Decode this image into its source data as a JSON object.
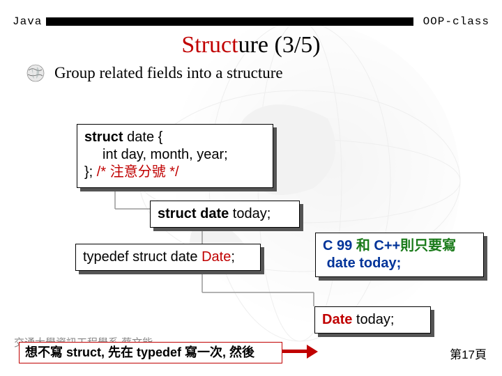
{
  "header": {
    "left_label": "Java",
    "right_label": "OOP-class"
  },
  "title": {
    "red_prefix": "Struct",
    "rest": "ure (3/5)"
  },
  "bullet": {
    "text": "Group related fields into a structure"
  },
  "box1": {
    "line1_pre": "struct",
    "line1_post": " date {",
    "line2": "int day, month, year;",
    "line3_code": "};",
    "line3_comment": " /* 注意分號 */"
  },
  "box2": {
    "pre": "struct date",
    "post": " today;"
  },
  "box3": {
    "pre": "typedef struct date ",
    "mid": "Date",
    "post": ";"
  },
  "box4": {
    "line1_a": "C 99 ",
    "line1_b": "和",
    "line1_c": " C++",
    "line1_d": "則只要寫",
    "line2": "date today;"
  },
  "box5": {
    "pre": "Date",
    "post": " today;"
  },
  "box6": {
    "text": "想不寫 struct, 先在 typedef 寫一次, 然後"
  },
  "footer": {
    "left": "交通大學資訊工程學系  蔡文能",
    "right": "第17頁"
  }
}
